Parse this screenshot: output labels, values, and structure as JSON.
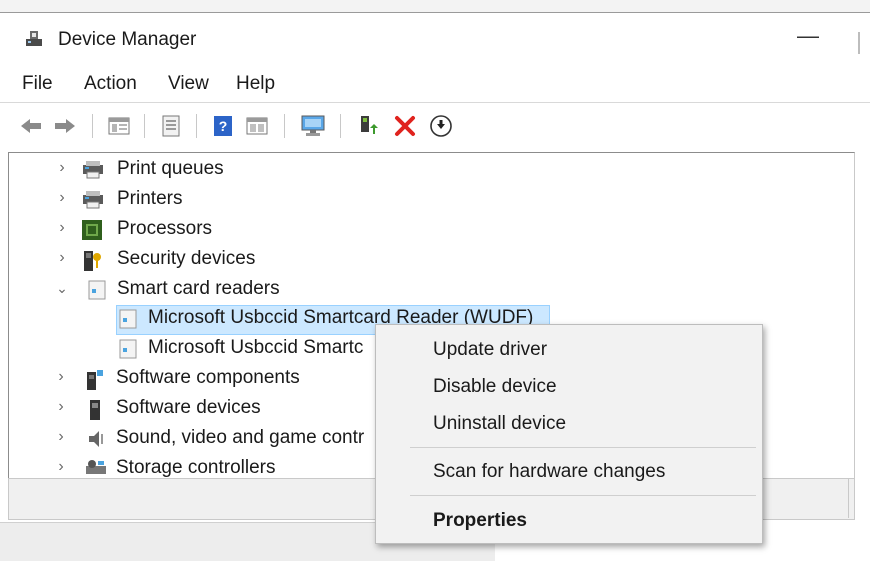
{
  "window": {
    "title": "Device Manager",
    "minimize_glyph": "—"
  },
  "menu": [
    "File",
    "Action",
    "View",
    "Help"
  ],
  "toolbar": {
    "icons": [
      "back-arrow-icon",
      "forward-arrow-icon",
      "show-hide-console-tree-icon",
      "properties-sheet-icon",
      "help-icon",
      "update-driver-icon",
      "scan-hardware-icon",
      "enable-device-icon",
      "uninstall-device-icon",
      "disable-device-icon"
    ],
    "colors": {
      "remove_red": "#e0231e",
      "help_blue": "#2c64c8",
      "monitor_blue": "#5aa7e8"
    }
  },
  "tree": {
    "rows": [
      {
        "label": "Print queues",
        "expanded": false,
        "icon": "print-queue-icon"
      },
      {
        "label": "Printers",
        "expanded": false,
        "icon": "printer-icon"
      },
      {
        "label": "Processors",
        "expanded": false,
        "icon": "processor-icon"
      },
      {
        "label": "Security devices",
        "expanded": false,
        "icon": "security-key-icon"
      },
      {
        "label": "Smart card readers",
        "expanded": true,
        "icon": "smart-card-reader-icon"
      },
      {
        "label": "Microsoft Usbccid Smartcard Reader (WUDF)",
        "child": true,
        "selected": true,
        "icon": "smart-card-device-icon"
      },
      {
        "label": "Microsoft Usbccid Smartc",
        "child": true,
        "icon": "smart-card-device-icon"
      },
      {
        "label": "Software components",
        "expanded": false,
        "icon": "software-component-icon"
      },
      {
        "label": "Software devices",
        "expanded": false,
        "icon": "software-device-icon"
      },
      {
        "label": "Sound, video and game contr",
        "expanded": false,
        "icon": "speaker-icon"
      },
      {
        "label": "Storage controllers",
        "expanded": false,
        "icon": "storage-controller-icon"
      }
    ],
    "selection_color": "#cce8ff"
  },
  "context_menu": {
    "items": [
      "Update driver",
      "Disable device",
      "Uninstall device",
      "Scan for hardware changes",
      "Properties"
    ],
    "default_item": "Properties"
  }
}
